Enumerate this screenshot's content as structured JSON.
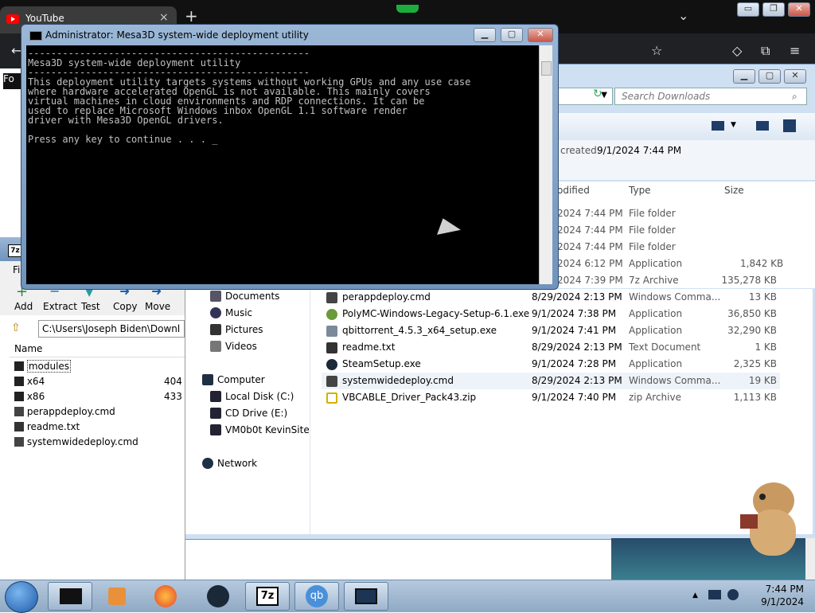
{
  "browser": {
    "tab_title": "YouTube",
    "tab_close": "×",
    "new_tab": "+",
    "tabs_menu": "⌄",
    "left_text": "Fo",
    "back_icon": "←",
    "star_icon": "☆",
    "pocket_icon": "◇",
    "extensions_icon": "⧉",
    "menu_icon": "≡",
    "win_min": "▭",
    "win_max": "❐",
    "win_close": "✕"
  },
  "cmd": {
    "title": "Administrator:  Mesa3D system-wide deployment utility",
    "lines": [
      "-------------------------------------------------",
      "Mesa3D system-wide deployment utility",
      "-------------------------------------------------",
      "This deployment utility targets systems without working GPUs and any use case",
      "where hardware accelerated OpenGL is not available. This mainly covers",
      "virtual machines in cloud environments and RDP connections. It can be",
      "used to replace Microsoft Windows inbox OpenGL 1.1 software render",
      "driver with Mesa3D OpenGL drivers.",
      "",
      "Press any key to continue . . . _"
    ],
    "min_label": "▁",
    "max_label": "▢",
    "close_label": "✕"
  },
  "explorer": {
    "search_placeholder": "Search Downloads",
    "date_created_label": "created:",
    "date_created_value": "9/1/2024 7:44 PM",
    "columns": {
      "modified": "odified",
      "type": "Type",
      "size": "Size"
    },
    "partial_rows": [
      {
        "date": "2024 7:44 PM",
        "type": "File folder",
        "size": ""
      },
      {
        "date": "2024 7:44 PM",
        "type": "File folder",
        "size": ""
      },
      {
        "date": "2024 7:44 PM",
        "type": "File folder",
        "size": ""
      },
      {
        "date": "2024 6:12 PM",
        "type": "Application",
        "size": "1,842 KB"
      },
      {
        "date": "2024 7:39 PM",
        "type": "7z Archive",
        "size": "135,278 KB"
      }
    ],
    "files": [
      {
        "name": "perappdeploy.cmd",
        "date": "8/29/2024 2:13 PM",
        "type": "Windows Comma...",
        "size": "13 KB",
        "icon": "#444"
      },
      {
        "name": "PolyMC-Windows-Legacy-Setup-6.1.exe",
        "date": "9/1/2024 7:38 PM",
        "type": "Application",
        "size": "36,850 KB",
        "icon": "#6a9a3a"
      },
      {
        "name": "qbittorrent_4.5.3_x64_setup.exe",
        "date": "9/1/2024 7:41 PM",
        "type": "Application",
        "size": "32,290 KB",
        "icon": "#7a8a9a"
      },
      {
        "name": "readme.txt",
        "date": "8/29/2024 2:13 PM",
        "type": "Text Document",
        "size": "1 KB",
        "icon": "#333"
      },
      {
        "name": "SteamSetup.exe",
        "date": "9/1/2024 7:28 PM",
        "type": "Application",
        "size": "2,325 KB",
        "icon": "#1b2838"
      },
      {
        "name": "systemwidedeploy.cmd",
        "date": "8/29/2024 2:13 PM",
        "type": "Windows Comma...",
        "size": "19 KB",
        "icon": "#444"
      },
      {
        "name": "VBCABLE_Driver_Pack43.zip",
        "date": "9/1/2024 7:40 PM",
        "type": "zip Archive",
        "size": "1,113 KB",
        "icon": "#d4b000"
      }
    ],
    "nav": {
      "documents": "Documents",
      "music": "Music",
      "pictures": "Pictures",
      "videos": "Videos",
      "computer": "Computer",
      "local_disk": "Local Disk (C:)",
      "cd_drive": "CD Drive (E:)",
      "vm_share": "VM0b0t KevinSite",
      "network": "Network"
    }
  },
  "sevenzip": {
    "title_icon": "7z",
    "menu_first": "Fi",
    "tools": [
      "Add",
      "Extract",
      "Test",
      "Copy",
      "Move"
    ],
    "path": "C:\\Users\\Joseph Biden\\Downl",
    "col_name": "Name",
    "rows": [
      {
        "name": "modules",
        "size": ""
      },
      {
        "name": "x64",
        "size": "404"
      },
      {
        "name": "x86",
        "size": "433"
      },
      {
        "name": "perappdeploy.cmd",
        "size": ""
      },
      {
        "name": "readme.txt",
        "size": ""
      },
      {
        "name": "systemwidedeploy.cmd",
        "size": ""
      }
    ]
  },
  "taskbar": {
    "time": "7:44 PM",
    "date": "9/1/2024",
    "sevenz_label": "7z",
    "qb_label": "qb",
    "show_hidden": "▲"
  }
}
